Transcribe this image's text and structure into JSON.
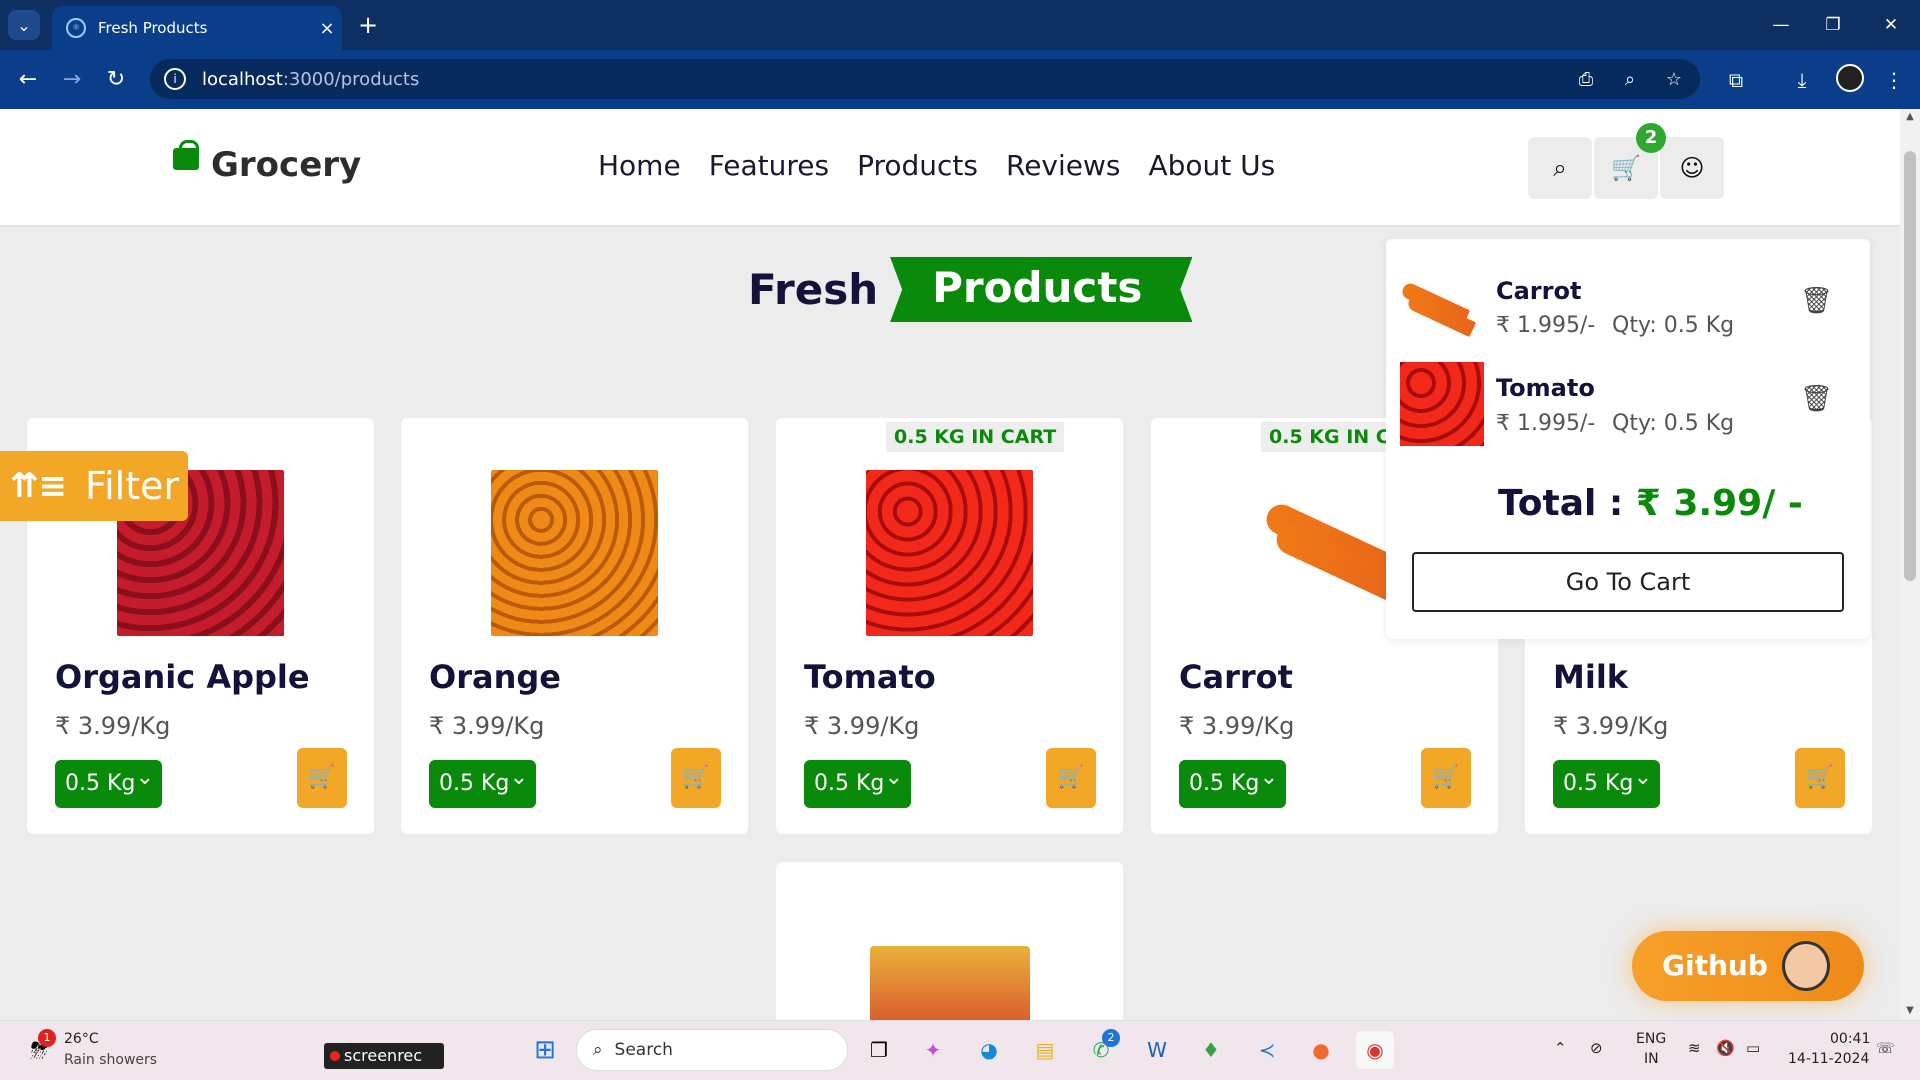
{
  "browser": {
    "tab_title": "Fresh Products",
    "url_host": "localhost",
    "url_path": ":3000/products",
    "colors": {
      "frame": "#0d2f61",
      "toolbar": "#0b3e8a"
    }
  },
  "site": {
    "logo_text": "Grocery",
    "nav": [
      "Home",
      "Features",
      "Products",
      "Reviews",
      "About Us"
    ],
    "cart_count": "2",
    "heading_plain": "Fresh",
    "heading_ribbon": "Products",
    "filter_label": "Filter",
    "accent_green": "#0a8a0a",
    "accent_orange": "#f3a726"
  },
  "products": [
    {
      "name": "Organic Apple",
      "price": "₹ 3.99/Kg",
      "qty": "0.5 Kg",
      "in_cart": ""
    },
    {
      "name": "Orange",
      "price": "₹ 3.99/Kg",
      "qty": "0.5 Kg",
      "in_cart": ""
    },
    {
      "name": "Tomato",
      "price": "₹ 3.99/Kg",
      "qty": "0.5 Kg",
      "in_cart": "0.5 KG IN CART"
    },
    {
      "name": "Carrot",
      "price": "₹ 3.99/Kg",
      "qty": "0.5 Kg",
      "in_cart": "0.5 KG IN CA"
    },
    {
      "name": "Milk",
      "price": "₹ 3.99/Kg",
      "qty": "0.5 Kg",
      "in_cart": ""
    }
  ],
  "cart_popup": {
    "items": [
      {
        "name": "Carrot",
        "price": "₹ 1.995/-",
        "qty": "Qty: 0.5 Kg"
      },
      {
        "name": "Tomato",
        "price": "₹ 1.995/-",
        "qty": "Qty: 0.5 Kg"
      }
    ],
    "total_label": "Total :",
    "total_value": "₹ 3.99/ -",
    "go_to_cart": "Go To Cart"
  },
  "github_label": "Github",
  "taskbar": {
    "weather_temp": "26°C",
    "weather_desc": "Rain showers",
    "weather_badge": "1",
    "screenrec": "screenrec",
    "search_placeholder": "Search",
    "whatsapp_badge": "2",
    "lang_1": "ENG",
    "lang_2": "IN",
    "time": "00:41",
    "date": "14-11-2024"
  }
}
